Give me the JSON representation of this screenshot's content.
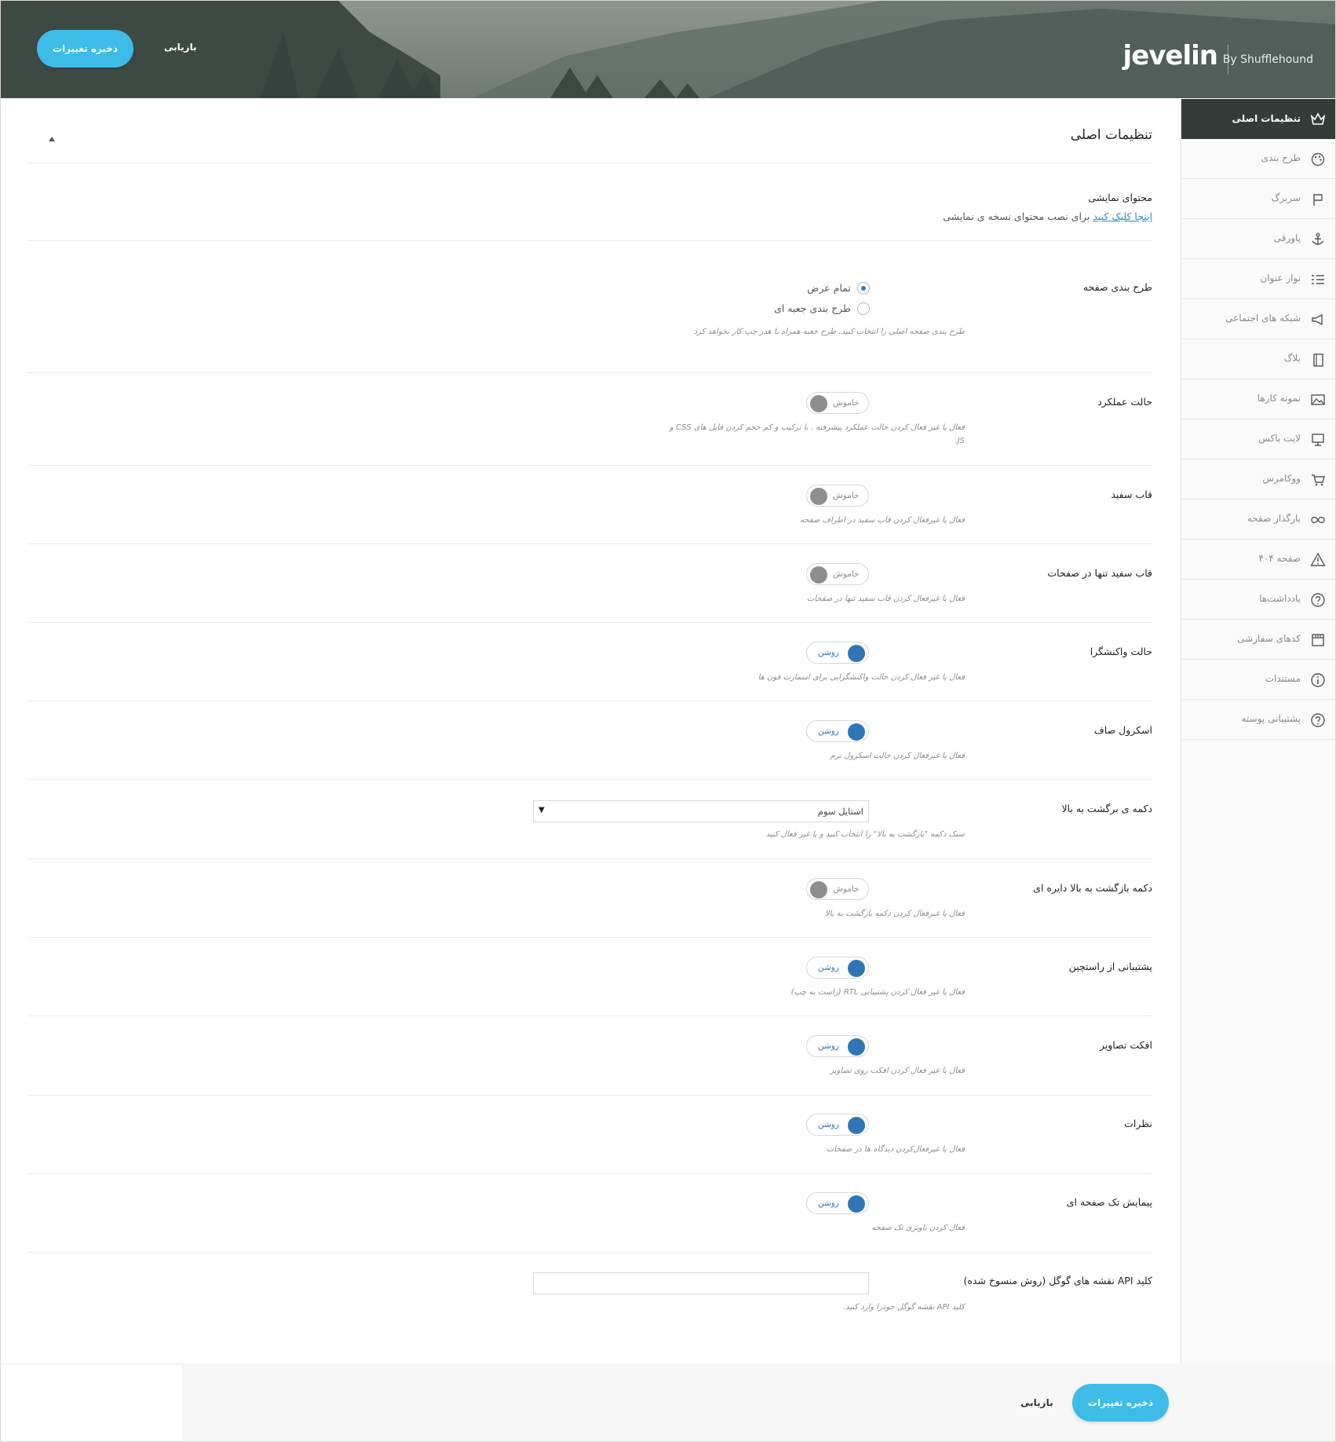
{
  "header": {
    "brand": "jevelin",
    "byline": "By Shufflehound",
    "save_label": "ذخیره تغییرات",
    "reset_label": "بازیابی"
  },
  "sidebar": {
    "items": [
      {
        "label": "تنظیمات اصلی",
        "icon": "crown-icon",
        "active": true
      },
      {
        "label": "طرح بندی",
        "icon": "palette-icon"
      },
      {
        "label": "سربرگ",
        "icon": "flag-icon"
      },
      {
        "label": "پاورقی",
        "icon": "anchor-icon"
      },
      {
        "label": "نوار عنوان",
        "icon": "list-icon"
      },
      {
        "label": "شبکه های اجتماعی",
        "icon": "megaphone-icon"
      },
      {
        "label": "بلاگ",
        "icon": "book-icon"
      },
      {
        "label": "نمونه کارها",
        "icon": "image-icon"
      },
      {
        "label": "لایت باکس",
        "icon": "monitor-icon"
      },
      {
        "label": "ووکامرس",
        "icon": "cart-icon"
      },
      {
        "label": "بارگذار صفحه",
        "icon": "infinity-icon"
      },
      {
        "label": "صفحه ۴۰۴",
        "icon": "warning-icon"
      },
      {
        "label": "یادداشت‌ها",
        "icon": "question-icon"
      },
      {
        "label": "کدهای سفارشی",
        "icon": "calendar-icon"
      },
      {
        "label": "مستندات",
        "icon": "info-icon"
      },
      {
        "label": "پشتیبانی پوسته",
        "icon": "help-icon"
      }
    ]
  },
  "main": {
    "title": "تنظیمات اصلی",
    "demo": {
      "label": "محتوای نمایشی",
      "link_text": "اینجا کلیک کنید",
      "rest_text": "برای نصب محتوای نسخه ی نمایشی"
    },
    "layout": {
      "label": "طرح بندی صفحه",
      "options": [
        "تمام عرض",
        "طرح بندی جعبه ای"
      ],
      "selected": "تمام عرض",
      "help": "طرح بندی صفحه اصلی را انتخاب کنید. طرح جعبه همراه با هدر چپ کار نخواهد کرد"
    },
    "performance": {
      "label": "حالت عملکرد",
      "state": "خاموش",
      "help": "فعال یا غیر فعال کردن حالت عملکرد پیشرفته . با ترکیب و کم حجم کردن فایل های CSS و JS."
    },
    "white_frame": {
      "label": "قاب سفید",
      "state": "خاموش",
      "help": "فعال یا غیرفعال کردن قاب سفید در اطراف صفحه"
    },
    "white_frame_pages": {
      "label": "قاب سفید تنها در صفحات",
      "state": "خاموش",
      "help": "فعال یا غیرفعال کردن قاب سفید تنها در صفحات"
    },
    "responsive": {
      "label": "حالت واکنشگرا",
      "state": "روشن",
      "help": "فعال یا غیر فعال کردن حالت واکنشگرایی برای اسمارت فون ها"
    },
    "smooth_scroll": {
      "label": "اسکرول صاف",
      "state": "روشن",
      "help": "فعال یا غیرفعال کردن حالت اسکرول نرم"
    },
    "back_to_top": {
      "label": "دکمه ی برگشت به بالا",
      "value": "استایل سوم",
      "help": "سبک دکمه \"بازگشت به بالا\" را انتخاب کنید و یا غیر فعال کنید"
    },
    "back_to_top_circle": {
      "label": "دکمه بازگشت به بالا دایره ای",
      "state": "خاموش",
      "help": "فعال یا غیرفعال کردن دکمه بازگشت به بالا"
    },
    "rtl": {
      "label": "پشتیبانی از راستچین",
      "state": "روشن",
      "help": "فعال یا غیر فعال کردن پشتیبانی RTL (راست به چپ)"
    },
    "image_effect": {
      "label": "افکت تصاویر",
      "state": "روشن",
      "help": "فعال یا غیر فعال کردن افکت روی تصاویر"
    },
    "comments": {
      "label": "نظرات",
      "state": "روشن",
      "help": "فعال یا غیرفعال‌کردن دیدگاه ها در صفحات"
    },
    "one_page_nav": {
      "label": "پیمایش تک صفحه ای",
      "state": "روشن",
      "help": "فعال کردن ناوبری تک صفحه"
    },
    "google_maps": {
      "label": "کلید API نقشه های گوگل (روش منسوخ شده)",
      "value": "",
      "help": "کلید API نقشه گوگل خودرا وارد کنید."
    }
  },
  "colors": {
    "accent": "#3dbce8",
    "toggle_on": "#2f76b5",
    "toggle_off": "#8e8e8e",
    "sidebar_active": "#343c3a"
  }
}
